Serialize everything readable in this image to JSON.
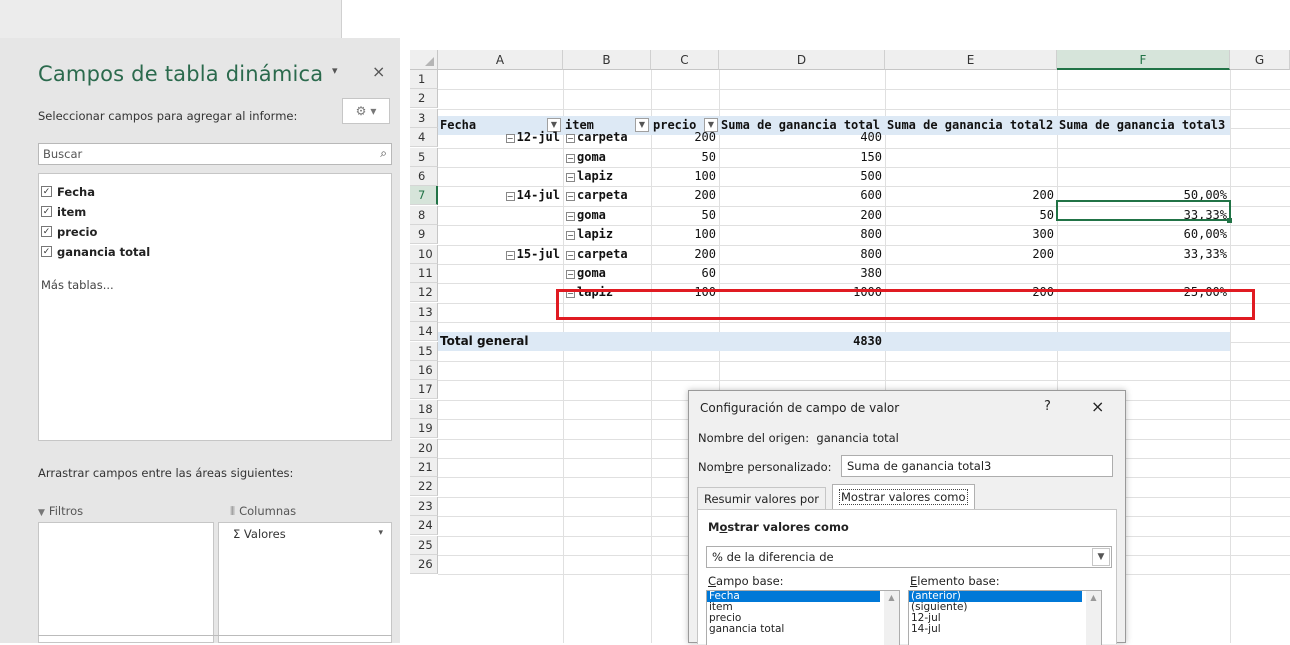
{
  "pane": {
    "title": "Campos de tabla dinámica",
    "subtitle": "Seleccionar campos para agregar al informe:",
    "search_placeholder": "Buscar",
    "fields": [
      {
        "label": "Fecha",
        "checked": true
      },
      {
        "label": "item",
        "checked": true
      },
      {
        "label": "precio",
        "checked": true
      },
      {
        "label": "ganancia total",
        "checked": true
      }
    ],
    "more_tables": "Más tablas...",
    "drag_label": "Arrastrar campos entre las áreas siguientes:",
    "filters_label": "Filtros",
    "columns_label": "Columnas",
    "values_chip": "Σ Valores",
    "glyphs": {
      "close": "×",
      "dropdown": "▾",
      "gear": "⚙",
      "search": "⌕",
      "check": "✓",
      "filter": "▼",
      "columns": "⦀"
    }
  },
  "grid": {
    "columns": [
      "A",
      "B",
      "C",
      "D",
      "E",
      "F",
      "G"
    ],
    "rows": [
      "1",
      "2",
      "3",
      "4",
      "5",
      "6",
      "7",
      "8",
      "9",
      "10",
      "11",
      "12",
      "13",
      "14",
      "15",
      "16",
      "17",
      "18",
      "19",
      "20",
      "21",
      "22",
      "23",
      "24",
      "25",
      "26"
    ],
    "selected_column": "F",
    "selected_row": "7",
    "headers": [
      "Fecha",
      "item",
      "precio",
      "Suma de ganancia total",
      "Suma de ganancia total2",
      "Suma de ganancia total3"
    ],
    "body": [
      {
        "fecha": "12-jul",
        "item": "carpeta",
        "precio": "200",
        "d": "400",
        "e": "",
        "f": ""
      },
      {
        "fecha": "",
        "item": "goma",
        "precio": "50",
        "d": "150",
        "e": "",
        "f": ""
      },
      {
        "fecha": "",
        "item": "lapiz",
        "precio": "100",
        "d": "500",
        "e": "",
        "f": ""
      },
      {
        "fecha": "14-jul",
        "item": "carpeta",
        "precio": "200",
        "d": "600",
        "e": "200",
        "f": "50,00%"
      },
      {
        "fecha": "",
        "item": "goma",
        "precio": "50",
        "d": "200",
        "e": "50",
        "f": "33,33%"
      },
      {
        "fecha": "",
        "item": "lapiz",
        "precio": "100",
        "d": "800",
        "e": "300",
        "f": "60,00%"
      },
      {
        "fecha": "15-jul",
        "item": "carpeta",
        "precio": "200",
        "d": "800",
        "e": "200",
        "f": "33,33%"
      },
      {
        "fecha": "",
        "item": "goma",
        "precio": "60",
        "d": "380",
        "e": "",
        "f": ""
      },
      {
        "fecha": "",
        "item": "lapiz",
        "precio": "100",
        "d": "1000",
        "e": "200",
        "f": "25,00%"
      }
    ],
    "total_label": "Total general",
    "total_value": "4830"
  },
  "dialog": {
    "title": "Configuración de campo de valor",
    "help": "?",
    "close": "×",
    "source_label": "Nombre del origen:",
    "source_value": "ganancia total",
    "custom_label_pre": "Nom",
    "custom_label_u": "b",
    "custom_label_post": "re personalizado:",
    "custom_value": "Suma de ganancia total3",
    "tab_summarize": "Resumir valores por",
    "tab_show_as": "Mostrar valores como",
    "section_title_pre": "M",
    "section_title_u": "o",
    "section_title_post": "strar valores como",
    "show_as_value": "% de la diferencia de",
    "base_field_u": "C",
    "base_field_rest": "ampo base:",
    "base_item_u": "E",
    "base_item_rest": "lemento base:",
    "base_fields": [
      "Fecha",
      "item",
      "precio",
      "ganancia total"
    ],
    "base_items": [
      "(anterior)",
      "(siguiente)",
      "12-jul",
      "14-jul"
    ]
  }
}
